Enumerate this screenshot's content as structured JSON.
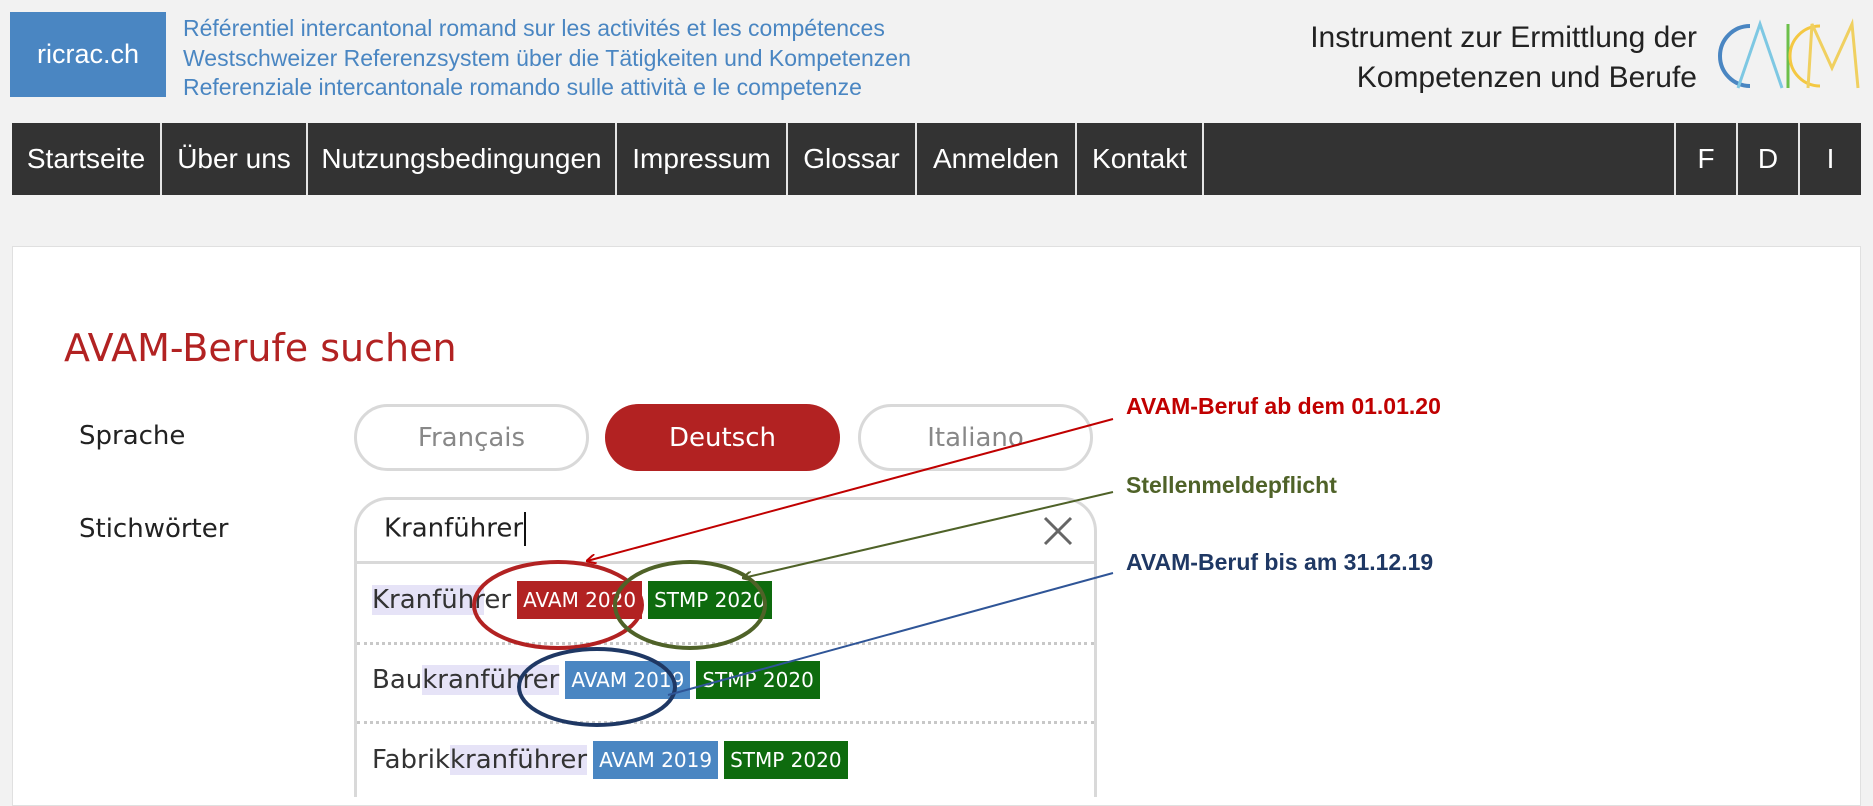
{
  "header": {
    "logo_text": "ricrac.ch",
    "taglines": [
      "Référentiel intercantonal romand sur les activités et les compétences",
      "Westschweizer Referenzsystem über die Tätigkeiten und Kompetenzen",
      "Referenziale intercantonale romando sulle attività e le competenze"
    ],
    "instrument_line1": "Instrument zur Ermittlung der",
    "instrument_line2": "Kompetenzen und Berufe",
    "instrument_logo_letters": "CAICM"
  },
  "nav": {
    "items": [
      "Startseite",
      "Über uns",
      "Nutzungsbedingungen",
      "Impressum",
      "Glossar",
      "Anmelden",
      "Kontakt"
    ],
    "languages": [
      "F",
      "D",
      "I"
    ]
  },
  "main": {
    "title": "AVAM-Berufe suchen",
    "language_label": "Sprache",
    "language_options": [
      "Français",
      "Deutsch",
      "Italiano"
    ],
    "selected_language": "Deutsch",
    "keywords_label": "Stichwörter",
    "search_value": "Kranführer",
    "results": [
      {
        "prefix": "",
        "match": "Kranführ",
        "suffix": "er",
        "tags": [
          {
            "label": "AVAM 2020",
            "type": "avam2020"
          },
          {
            "label": "STMP 2020",
            "type": "stmp"
          }
        ]
      },
      {
        "prefix": "Bau",
        "match": "kranführer",
        "suffix": "",
        "tags": [
          {
            "label": "AVAM 2019",
            "type": "avam2019"
          },
          {
            "label": "STMP 2020",
            "type": "stmp"
          }
        ]
      },
      {
        "prefix": "Fabrik",
        "match": "kranführer",
        "suffix": "",
        "tags": [
          {
            "label": "AVAM 2019",
            "type": "avam2019"
          },
          {
            "label": "STMP 2020",
            "type": "stmp"
          }
        ]
      }
    ]
  },
  "annotations": {
    "avam_new": "AVAM-Beruf ab dem 01.01.20",
    "stmp": "Stellenmeldepflicht",
    "avam_old": "AVAM-Beruf bis am 31.12.19"
  },
  "colors": {
    "brand_blue": "#4a86c2",
    "nav_bg": "#333333",
    "accent_red": "#b22222",
    "avam2020": "#b22222",
    "avam2019": "#4a86c2",
    "stmp": "#0e6b0e",
    "annot_red": "#c00000",
    "annot_green": "#4f6228",
    "annot_blue": "#1f3864"
  }
}
